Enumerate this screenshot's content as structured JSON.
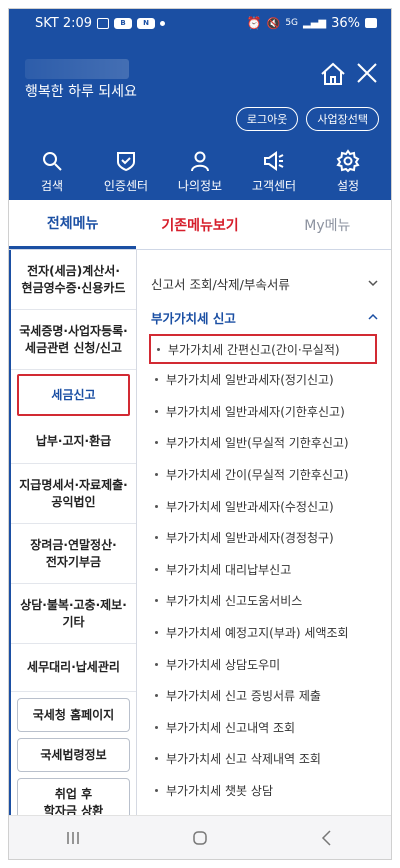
{
  "status_bar": {
    "carrier_time": "SKT 2:09",
    "icon_b": "B",
    "icon_n": "N",
    "battery": "36%",
    "signal_label": "5G"
  },
  "header": {
    "greeting": "행복한 하루 되세요",
    "logout_label": "로그아웃",
    "business_select_label": "사업장선택",
    "quick": [
      {
        "label": "검색",
        "icon": "search-icon"
      },
      {
        "label": "인증센터",
        "icon": "shield-check-icon"
      },
      {
        "label": "나의정보",
        "icon": "user-icon"
      },
      {
        "label": "고객센터",
        "icon": "megaphone-icon"
      },
      {
        "label": "설정",
        "icon": "gear-icon"
      }
    ]
  },
  "tabs": [
    {
      "label": "전체메뉴"
    },
    {
      "label": "기존메뉴보기"
    },
    {
      "label": "My메뉴"
    }
  ],
  "categories": [
    {
      "label": "전자(세금)계산서·\n현금영수증·신용카드"
    },
    {
      "label": "국세증명·사업자등록·\n세금관련 신청/신고"
    },
    {
      "label": "세금신고"
    },
    {
      "label": "납부·고지·환급"
    },
    {
      "label": "지급명세서·자료제출·\n공익법인"
    },
    {
      "label": "장려금·연말정산·\n전자기부금"
    },
    {
      "label": "상담·불복·고충·제보·\n기타"
    },
    {
      "label": "세무대리·납세관리"
    }
  ],
  "category_buttons": [
    {
      "label": "국세청 홈페이지"
    },
    {
      "label": "국세법령정보"
    },
    {
      "label": "취업 후\n학자금 상환"
    }
  ],
  "section_collapsed": "신고서 조회/삭제/부속서류",
  "section_open": "부가가치세 신고",
  "items": [
    "부가가치세 간편신고(간이·무실적)",
    "부가가치세 일반과세자(정기신고)",
    "부가가치세 일반과세자(기한후신고)",
    "부가가치세 일반(무실적 기한후신고)",
    "부가가치세 간이(무실적 기한후신고)",
    "부가가치세 일반과세자(수정신고)",
    "부가가치세 일반과세자(경정청구)",
    "부가가치세 대리납부신고",
    "부가가치세 신고도움서비스",
    "부가가치세 예정고지(부과) 세액조회",
    "부가가치세 상담도우미",
    "부가가치세 신고 증빙서류 제출",
    "부가가치세 신고내역 조회",
    "부가가치세 신고 삭제내역 조회",
    "부가가치세 챗봇 상담"
  ],
  "colors": {
    "brand_blue": "#1b4fa3",
    "accent_red": "#d22a33"
  }
}
